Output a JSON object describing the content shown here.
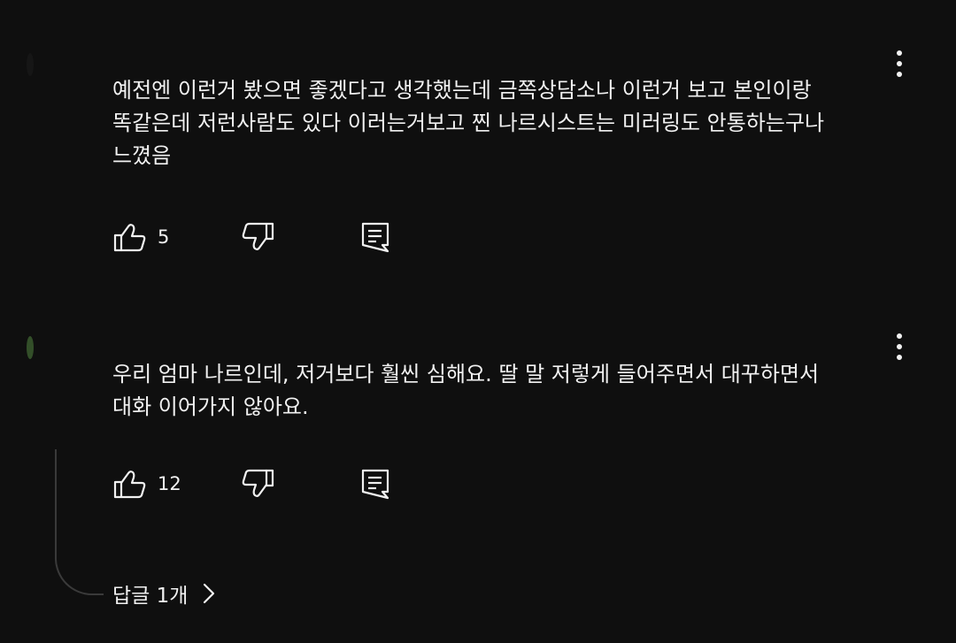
{
  "comments": [
    {
      "author": "",
      "text": "예전엔 이런거 봤으면 좋겠다고 생각했는데   금쪽상담소나 이런거 보고 본인이랑\n똑같은데 저런사람도 있다 이러는거보고 찐 나르시스트는 미러링도 안통하는구나\n느꼈음",
      "likes": "5",
      "icons": {
        "like": "thumbs-up-icon",
        "dislike": "thumbs-down-icon",
        "reply": "reply-comment-icon",
        "more": "more-vertical-icon"
      }
    },
    {
      "author": "",
      "text": "우리 엄마 나르인데, 저거보다 훨씬 심해요. 딸 말 저렇게 들어주면서 대꾸하면서\n대화 이어가지 않아요.",
      "likes": "12",
      "replies_label": "답글 1개",
      "icons": {
        "like": "thumbs-up-icon",
        "dislike": "thumbs-down-icon",
        "reply": "reply-comment-icon",
        "more": "more-vertical-icon",
        "expand": "chevron-right-icon"
      }
    }
  ],
  "colors": {
    "background": "#0f0f0f",
    "text": "#f1f1f1",
    "thread_line": "#3a3a3a"
  }
}
